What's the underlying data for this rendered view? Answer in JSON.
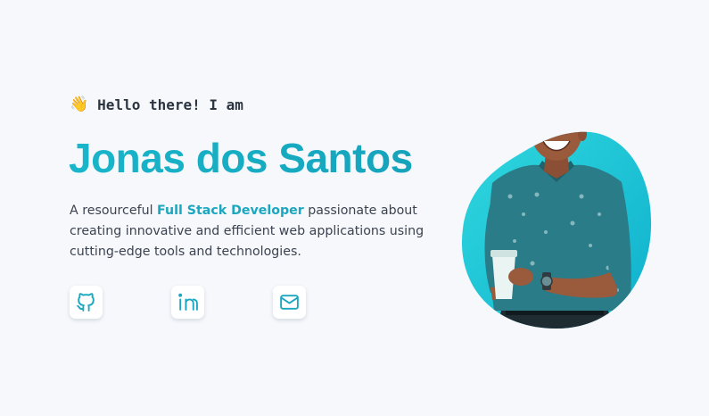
{
  "hero": {
    "wave_emoji": "👋",
    "greeting": "Hello there! I am",
    "name": "Jonas dos Santos",
    "description": {
      "prefix": "A resourceful ",
      "highlight": "Full Stack Developer",
      "suffix": " passionate about creating innovative and efficient web applications using cutting-edge tools and technologies."
    }
  },
  "socials": [
    {
      "icon": "github-icon"
    },
    {
      "icon": "linkedin-icon"
    },
    {
      "icon": "mail-icon"
    }
  ],
  "colors": {
    "accent": "#16b1c6",
    "blob_light": "#2fd8df",
    "blob_dark": "#0fb0cc",
    "text": "#3c4350",
    "background": "#f6f8fc"
  }
}
